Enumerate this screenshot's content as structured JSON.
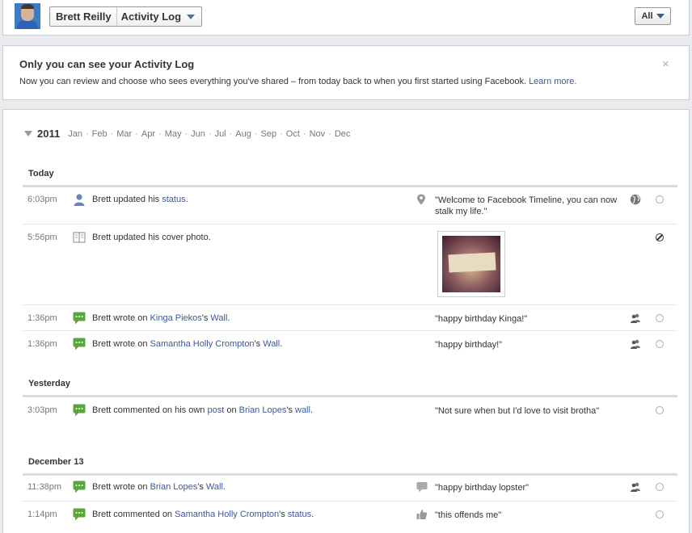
{
  "header": {
    "user_name": "Brett Reilly",
    "page_title": "Activity Log",
    "filter_label": "All"
  },
  "notice": {
    "title": "Only you can see your Activity Log",
    "body": "Now you can review and choose who sees everything you've shared – from today back to when you first started using Facebook.",
    "learn_more": "Learn more.",
    "close": "×"
  },
  "timeline": {
    "year": "2011",
    "months": [
      "Jan",
      "Feb",
      "Mar",
      "Apr",
      "May",
      "Jun",
      "Jul",
      "Aug",
      "Sep",
      "Oct",
      "Nov",
      "Dec"
    ],
    "sections": [
      {
        "label": "Today"
      },
      {
        "label": "Yesterday"
      },
      {
        "label": "December 13"
      }
    ],
    "rows": [
      {
        "time": "6:03pm",
        "icon": "person-icon",
        "parts": [
          {
            "t": "Brett updated his "
          },
          {
            "t": "status",
            "link": true
          },
          {
            "t": "."
          }
        ],
        "quote": "\"Welcome to Facebook Timeline, you can now stalk my life.\"",
        "side_icon": "location-pin-icon",
        "audience": "globe-icon",
        "status": "circle"
      },
      {
        "time": "5:56pm",
        "icon": "cover-photo-icon",
        "parts": [
          {
            "t": "Brett updated his cover photo."
          }
        ],
        "quote": "",
        "photo": true,
        "status": "hidden"
      },
      {
        "time": "1:36pm",
        "icon": "wall-post-icon",
        "parts": [
          {
            "t": "Brett wrote on "
          },
          {
            "t": "Kinga Piekos",
            "link": true
          },
          {
            "t": "'s "
          },
          {
            "t": "Wall",
            "link": true
          },
          {
            "t": "."
          }
        ],
        "quote": "\"happy birthday Kinga!\"",
        "audience": "friends-icon",
        "status": "circle"
      },
      {
        "time": "1:36pm",
        "icon": "wall-post-icon",
        "parts": [
          {
            "t": "Brett wrote on "
          },
          {
            "t": "Samantha Holly Crompton",
            "link": true
          },
          {
            "t": "'s "
          },
          {
            "t": "Wall",
            "link": true
          },
          {
            "t": "."
          }
        ],
        "quote": "\"happy birthday!\"",
        "audience": "friends-icon",
        "status": "circle"
      },
      {
        "time": "3:03pm",
        "icon": "comment-icon",
        "parts": [
          {
            "t": "Brett commented on his own "
          },
          {
            "t": "post",
            "link": true
          },
          {
            "t": " on "
          },
          {
            "t": "Brian Lopes",
            "link": true
          },
          {
            "t": "'s "
          },
          {
            "t": "wall",
            "link": true
          },
          {
            "t": "."
          }
        ],
        "quote": "\"Not sure when but I'd love to visit brotha\"",
        "status": "circle"
      },
      {
        "time": "11:38pm",
        "icon": "wall-post-icon",
        "parts": [
          {
            "t": "Brett wrote on "
          },
          {
            "t": "Brian Lopes",
            "link": true
          },
          {
            "t": "'s "
          },
          {
            "t": "Wall",
            "link": true
          },
          {
            "t": "."
          }
        ],
        "quote": "\"happy birthday lopster\"",
        "side_icon": "speech-bubble-icon",
        "audience": "friends-icon",
        "status": "circle"
      },
      {
        "time": "1:14pm",
        "icon": "comment-icon",
        "parts": [
          {
            "t": "Brett commented on "
          },
          {
            "t": "Samantha Holly Crompton",
            "link": true
          },
          {
            "t": "'s "
          },
          {
            "t": "status",
            "link": true
          },
          {
            "t": "."
          }
        ],
        "quote": "\"this offends me\"",
        "side_icon": "thumbs-up-icon",
        "status": "circle"
      }
    ]
  },
  "colors": {
    "link": "#3b5998",
    "border": "#c4cde0",
    "background": "#e9ebee",
    "chat_green": "#5aa63b"
  }
}
